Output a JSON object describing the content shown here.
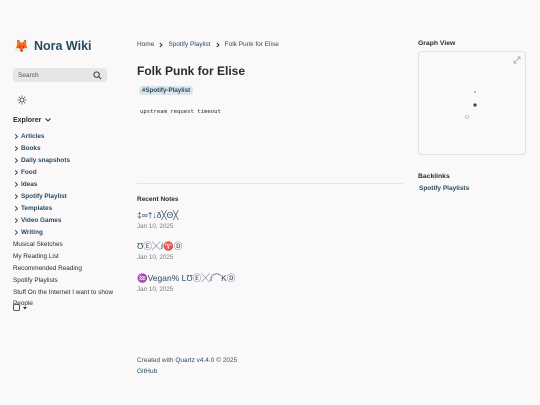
{
  "site": {
    "title": "Nora Wiki",
    "logo_icon": "fox-icon"
  },
  "search": {
    "placeholder": "Search"
  },
  "explorer": {
    "title": "Explorer",
    "folders": [
      "Articles",
      "Books",
      "Daily snapshots",
      "Food",
      "Ideas",
      "Spotify Playlist",
      "Templates",
      "Video Games",
      "Writing"
    ],
    "files": [
      "Musical Sketches",
      "My Reading List",
      "Recommended Reading",
      "Spotify Playlists",
      "Stuff On the Internet I want to show People"
    ]
  },
  "breadcrumbs": [
    "Home",
    "Spotify Playlist",
    "Folk Punk for Elise"
  ],
  "page": {
    "title": "Folk Punk for Elise",
    "tag": "#Spotify-Playlist",
    "content": "upstream request timeout"
  },
  "recent": {
    "heading": "Recent Notes",
    "notes": [
      {
        "title": "‡∞†↓δ╳Θ╳",
        "date": "Jan 10, 2025"
      },
      {
        "title": "ƱⒺ╳ⅈ♈Ⓓ",
        "date": "Jan 10, 2025"
      },
      {
        "title": "♒Vegan% LƱⒺ╳ⅈ⌒KⒹ",
        "date": "Jan 10, 2025"
      }
    ]
  },
  "footer": {
    "created_with": "Created with",
    "quartz": "Quartz v4.4.0",
    "year": "© 2025",
    "github": "GitHub"
  },
  "graph": {
    "heading": "Graph View"
  },
  "backlinks": {
    "heading": "Backlinks",
    "items": [
      "Spotify Playlists"
    ]
  },
  "colors": {
    "accent": "#284b63",
    "background": "#faf8f8",
    "text": "#2b2b2b",
    "muted": "#7b7b7b",
    "tag_bg": "#dbe4ea"
  }
}
